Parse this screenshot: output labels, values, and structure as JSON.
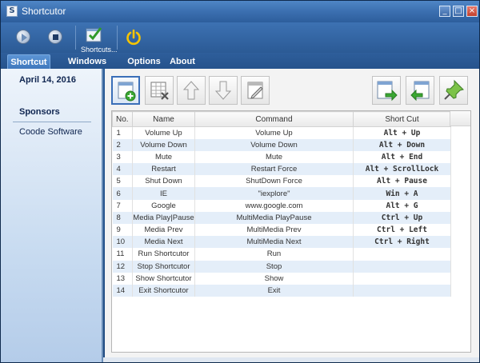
{
  "window": {
    "title": "Shortcutor"
  },
  "titlebar": {
    "minimize": "_",
    "maximize": "□",
    "close": "×"
  },
  "toolbar": {
    "play": "play-button",
    "stop": "stop-button",
    "shortcuts_label": "Shortcuts...",
    "power": "power-button"
  },
  "tabs": [
    {
      "label": "Shortcut",
      "active": true
    },
    {
      "label": "Windows Default",
      "active": false
    },
    {
      "label": "Options",
      "active": false
    },
    {
      "label": "About",
      "active": false
    }
  ],
  "sidebar": {
    "date": "April 14, 2016",
    "sponsors_heading": "Sponsors",
    "sponsor_link": "Coode Software"
  },
  "table": {
    "columns": [
      "No.",
      "Name",
      "Command",
      "Short Cut"
    ],
    "rows": [
      [
        "1",
        "Volume Up",
        "Volume Up",
        "Alt + Up"
      ],
      [
        "2",
        "Volume Down",
        "Volume Down",
        "Alt + Down"
      ],
      [
        "3",
        "Mute",
        "Mute",
        "Alt + End"
      ],
      [
        "4",
        "Restart",
        "Restart Force",
        "Alt + ScrollLock"
      ],
      [
        "5",
        "Shut Down",
        "ShutDown Force",
        "Alt + Pause"
      ],
      [
        "6",
        "IE",
        "\"iexplore\"",
        "Win + A"
      ],
      [
        "7",
        "Google",
        "www.google.com",
        "Alt + G"
      ],
      [
        "8",
        "Media Play|Pause",
        "MultiMedia PlayPause",
        "Ctrl + Up"
      ],
      [
        "9",
        "Media Prev",
        "MultiMedia Prev",
        "Ctrl + Left"
      ],
      [
        "10",
        "Media Next",
        "MultiMedia Next",
        "Ctrl + Right"
      ],
      [
        "11",
        "Run Shortcutor",
        "Run",
        ""
      ],
      [
        "12",
        "Stop Shortcutor",
        "Stop",
        ""
      ],
      [
        "13",
        "Show Shortcutor",
        "Show",
        ""
      ],
      [
        "14",
        "Exit Shortcutor",
        "Exit",
        ""
      ]
    ]
  },
  "colors": {
    "accent": "#3b6fb0",
    "row_alt": "#e4eef9",
    "power_icon": "#f5c400",
    "add_icon": "#3aa832",
    "pin_icon": "#5aa53a"
  }
}
